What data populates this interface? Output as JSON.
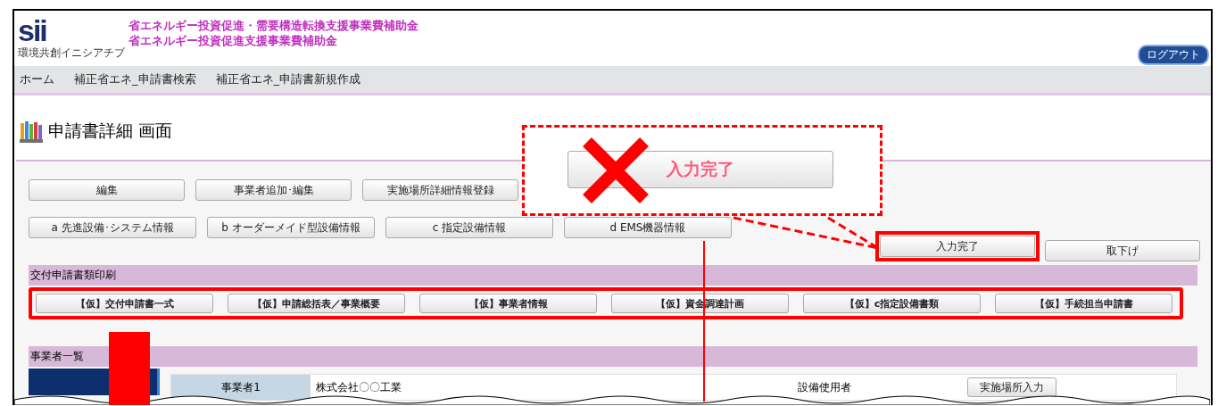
{
  "header": {
    "logo": "sii",
    "logo_caption": "環境共創イニシアチブ",
    "titles": [
      "省エネルギー投資促進・需要構造転換支援事業費補助金",
      "省エネルギー投資促進支援事業費補助金"
    ],
    "logout": "ログアウト"
  },
  "nav": [
    "ホーム",
    "補正省エネ_申請書検索",
    "補正省エネ_申請書新規作成"
  ],
  "page_title": "申請書詳細 画面",
  "action_rows": [
    [
      "編集",
      "事業者追加･編集",
      "実施場所詳細情報登録"
    ],
    [
      "a 先進設備･システム情報",
      "b オーダーメイド型設備情報",
      "c 指定設備情報",
      "d EMS機器情報"
    ]
  ],
  "right_buttons": [
    {
      "label": "入力完了",
      "highlighted": true
    },
    {
      "label": "取下げ",
      "highlighted": false
    }
  ],
  "print_section": {
    "title": "交付申請書類印刷",
    "buttons": [
      "【仮】交付申請書一式",
      "【仮】申請総括表／事業概要",
      "【仮】事業者情報",
      "【仮】資金調達計画",
      "【仮】c指定設備書類",
      "【仮】手続担当申請書"
    ]
  },
  "business_section": {
    "title": "事業者一覧",
    "row": {
      "label": "事業者1",
      "name": "株式会社〇〇工業",
      "role": "設備使用者",
      "button": "実施場所入力"
    }
  },
  "callout": {
    "button": "入力完了"
  }
}
